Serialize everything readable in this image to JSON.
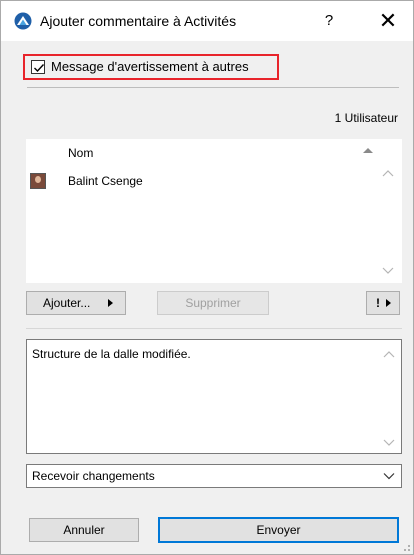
{
  "window": {
    "title": "Ajouter commentaire à Activités",
    "help_label": "?",
    "close_label": "✕"
  },
  "warn": {
    "label": "Message d'avertissement à autres",
    "checked": true,
    "highlight_color": "#e8242b"
  },
  "users": {
    "count_text": "1 Utilisateur",
    "column_header": "Nom",
    "items": [
      {
        "name": "Balint Csenge",
        "icon": "user-avatar"
      }
    ]
  },
  "buttons": {
    "add_label": "Ajouter...",
    "delete_label": "Supprimer",
    "flag_label": "!"
  },
  "comment": {
    "text": "Structure de la dalle modifiée."
  },
  "notify_select": {
    "value": "Recevoir changements"
  },
  "footer": {
    "cancel_label": "Annuler",
    "send_label": "Envoyer",
    "accent_color": "#0078d7"
  }
}
